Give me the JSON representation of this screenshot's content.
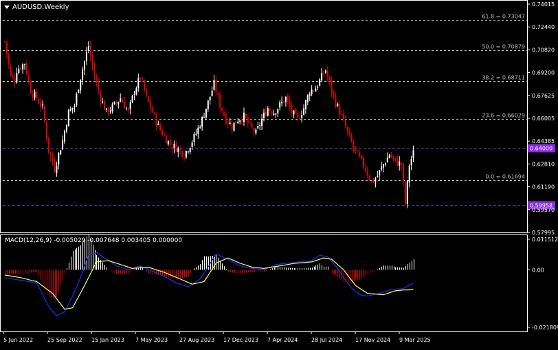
{
  "header": {
    "symbol_title": "AUDUSD,Weekly"
  },
  "macd_header": {
    "label": "MACD(12,26,9) -0.005029 -0.007648 0.003405 0.000000"
  },
  "colors": {
    "background": "#000000",
    "axis": "#ffffff",
    "bull_candle": "#ffffff",
    "bear_candle": "#e00000",
    "fib_line": "#bfbfbf",
    "price_line": "#7b2bd8",
    "price_tag_bg": "#8a2be2",
    "macd_line": "#1e2cff",
    "signal_line": "#ffff66",
    "hist_pos": "#ffffff",
    "hist_neg": "#e00000"
  },
  "chart_data": [
    {
      "type": "candlestick",
      "title": "AUDUSD,Weekly",
      "ylim": [
        0.5799,
        0.7415
      ],
      "y_ticks": [
        "0.74015",
        "0.72440",
        "0.70820",
        "0.69200",
        "0.67625",
        "0.66005",
        "0.64385",
        "0.62810",
        "0.61190",
        "0.59570",
        "0.57995"
      ],
      "x_ticks": [
        "5 Jun 2022",
        "25 Sep 2022",
        "15 Jan 2023",
        "7 May 2023",
        "27 Aug 2023",
        "17 Dec 2023",
        "7 Apr 2024",
        "28 Jul 2024",
        "17 Nov 2024",
        "9 Mar 2025"
      ],
      "fib_levels": [
        {
          "label": "61.8 = 0.73047",
          "value": 0.73047
        },
        {
          "label": "50.0 = 0.70879",
          "value": 0.70879
        },
        {
          "label": "38.2 = 0.68711",
          "value": 0.68711
        },
        {
          "label": "23.6 = 0.66029",
          "value": 0.66029
        },
        {
          "label": "0.0 = 0.61694",
          "value": 0.61694
        }
      ],
      "price_lines": [
        {
          "label": "0.64000",
          "value": 0.64
        },
        {
          "label": "0.59958",
          "value": 0.5996
        }
      ],
      "close_anchors": [
        [
          0,
          0.715
        ],
        [
          3,
          0.69
        ],
        [
          5,
          0.688
        ],
        [
          6,
          0.695
        ],
        [
          10,
          0.7
        ],
        [
          13,
          0.68
        ],
        [
          16,
          0.675
        ],
        [
          19,
          0.668
        ],
        [
          22,
          0.638
        ],
        [
          25,
          0.625
        ],
        [
          29,
          0.645
        ],
        [
          32,
          0.665
        ],
        [
          35,
          0.67
        ],
        [
          38,
          0.69
        ],
        [
          42,
          0.712
        ],
        [
          45,
          0.69
        ],
        [
          48,
          0.675
        ],
        [
          51,
          0.665
        ],
        [
          55,
          0.67
        ],
        [
          58,
          0.675
        ],
        [
          62,
          0.665
        ],
        [
          65,
          0.68
        ],
        [
          68,
          0.69
        ],
        [
          71,
          0.675
        ],
        [
          74,
          0.665
        ],
        [
          77,
          0.655
        ],
        [
          80,
          0.648
        ],
        [
          83,
          0.642
        ],
        [
          86,
          0.64
        ],
        [
          90,
          0.635
        ],
        [
          93,
          0.642
        ],
        [
          96,
          0.65
        ],
        [
          99,
          0.66
        ],
        [
          102,
          0.672
        ],
        [
          105,
          0.685
        ],
        [
          108,
          0.67
        ],
        [
          111,
          0.66
        ],
        [
          114,
          0.655
        ],
        [
          117,
          0.66
        ],
        [
          120,
          0.662
        ],
        [
          123,
          0.655
        ],
        [
          126,
          0.65
        ],
        [
          129,
          0.66
        ],
        [
          132,
          0.668
        ],
        [
          135,
          0.665
        ],
        [
          138,
          0.67
        ],
        [
          141,
          0.675
        ],
        [
          144,
          0.665
        ],
        [
          147,
          0.66
        ],
        [
          150,
          0.668
        ],
        [
          153,
          0.68
        ],
        [
          156,
          0.682
        ],
        [
          159,
          0.69
        ],
        [
          161,
          0.695
        ],
        [
          163,
          0.685
        ],
        [
          166,
          0.672
        ],
        [
          169,
          0.662
        ],
        [
          172,
          0.65
        ],
        [
          175,
          0.64
        ],
        [
          178,
          0.632
        ],
        [
          181,
          0.625
        ],
        [
          184,
          0.615
        ],
        [
          187,
          0.62
        ],
        [
          190,
          0.628
        ],
        [
          193,
          0.635
        ],
        [
          196,
          0.63
        ],
        [
          199,
          0.628
        ],
        [
          201,
          0.6
        ],
        [
          203,
          0.628
        ],
        [
          205,
          0.636
        ]
      ],
      "macd": {
        "ylim": [
          -0.0219,
          0.0116
        ],
        "y_ticks": [
          "0.011512",
          "0.00",
          "-0.021809"
        ],
        "macd_anchors": [
          [
            0,
            -0.003
          ],
          [
            8,
            -0.004
          ],
          [
            16,
            -0.005
          ],
          [
            22,
            -0.014
          ],
          [
            26,
            -0.0175
          ],
          [
            30,
            -0.016
          ],
          [
            34,
            -0.01
          ],
          [
            38,
            -0.003
          ],
          [
            42,
            0.0055
          ],
          [
            46,
            0.0065
          ],
          [
            50,
            0.0045
          ],
          [
            56,
            0.0015
          ],
          [
            62,
            0.0
          ],
          [
            68,
            0.0015
          ],
          [
            74,
            -0.0005
          ],
          [
            80,
            -0.0025
          ],
          [
            86,
            -0.005
          ],
          [
            92,
            -0.0065
          ],
          [
            98,
            -0.0035
          ],
          [
            102,
            0.001
          ],
          [
            106,
            0.006
          ],
          [
            112,
            0.004
          ],
          [
            118,
            0.0015
          ],
          [
            124,
            0.0005
          ],
          [
            130,
            0.0
          ],
          [
            136,
            0.002
          ],
          [
            142,
            0.0025
          ],
          [
            148,
            0.003
          ],
          [
            154,
            0.0035
          ],
          [
            158,
            0.0055
          ],
          [
            162,
            0.005
          ],
          [
            166,
            0.0015
          ],
          [
            170,
            -0.003
          ],
          [
            174,
            -0.007
          ],
          [
            178,
            -0.0095
          ],
          [
            182,
            -0.01
          ],
          [
            188,
            -0.009
          ],
          [
            194,
            -0.0075
          ],
          [
            200,
            -0.0072
          ],
          [
            205,
            -0.005
          ]
        ],
        "signal_anchors": [
          [
            0,
            -0.002
          ],
          [
            8,
            -0.003
          ],
          [
            16,
            -0.0045
          ],
          [
            24,
            -0.009
          ],
          [
            30,
            -0.015
          ],
          [
            34,
            -0.0145
          ],
          [
            40,
            -0.006
          ],
          [
            46,
            0.003
          ],
          [
            52,
            0.0035
          ],
          [
            58,
            0.002
          ],
          [
            64,
            0.0005
          ],
          [
            72,
            0.001
          ],
          [
            80,
            -0.001
          ],
          [
            88,
            -0.0035
          ],
          [
            94,
            -0.0055
          ],
          [
            100,
            -0.0045
          ],
          [
            106,
            0.0025
          ],
          [
            112,
            0.0045
          ],
          [
            118,
            0.0025
          ],
          [
            124,
            0.001
          ],
          [
            130,
            0.0005
          ],
          [
            138,
            0.0015
          ],
          [
            146,
            0.0025
          ],
          [
            154,
            0.003
          ],
          [
            160,
            0.0045
          ],
          [
            164,
            0.004
          ],
          [
            170,
            0.0
          ],
          [
            176,
            -0.006
          ],
          [
            182,
            -0.009
          ],
          [
            190,
            -0.0095
          ],
          [
            196,
            -0.008
          ],
          [
            200,
            -0.0077
          ],
          [
            205,
            -0.0076
          ]
        ]
      }
    }
  ]
}
